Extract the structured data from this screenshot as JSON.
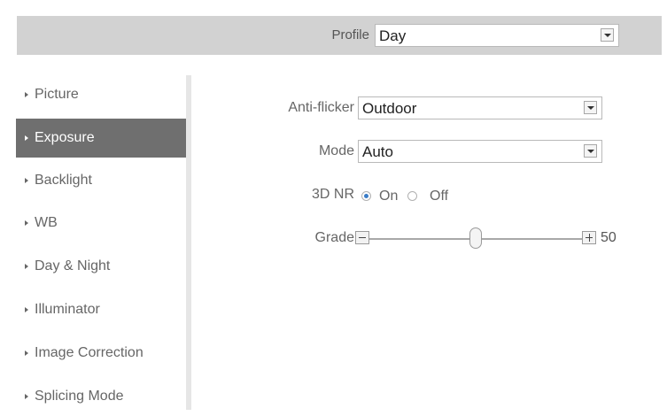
{
  "profile": {
    "label": "Profile",
    "value": "Day"
  },
  "sidebar": {
    "items": [
      {
        "label": "Picture",
        "active": false
      },
      {
        "label": "Exposure",
        "active": true
      },
      {
        "label": "Backlight",
        "active": false
      },
      {
        "label": "WB",
        "active": false
      },
      {
        "label": "Day & Night",
        "active": false
      },
      {
        "label": "Illuminator",
        "active": false
      },
      {
        "label": "Image Correction",
        "active": false
      },
      {
        "label": "Splicing Mode",
        "active": false
      }
    ]
  },
  "exposure": {
    "anti_flicker": {
      "label": "Anti-flicker",
      "value": "Outdoor"
    },
    "mode": {
      "label": "Mode",
      "value": "Auto"
    },
    "nr3d": {
      "label": "3D NR",
      "on_label": "On",
      "off_label": "Off",
      "selected": "On"
    },
    "grade": {
      "label": "Grade",
      "value": "50",
      "level_fraction": 0.5
    }
  },
  "colors": {
    "accent": "#3a7cc7",
    "active_item_bg": "#6f6f6f",
    "profile_bar_bg": "#d2d2d2"
  }
}
